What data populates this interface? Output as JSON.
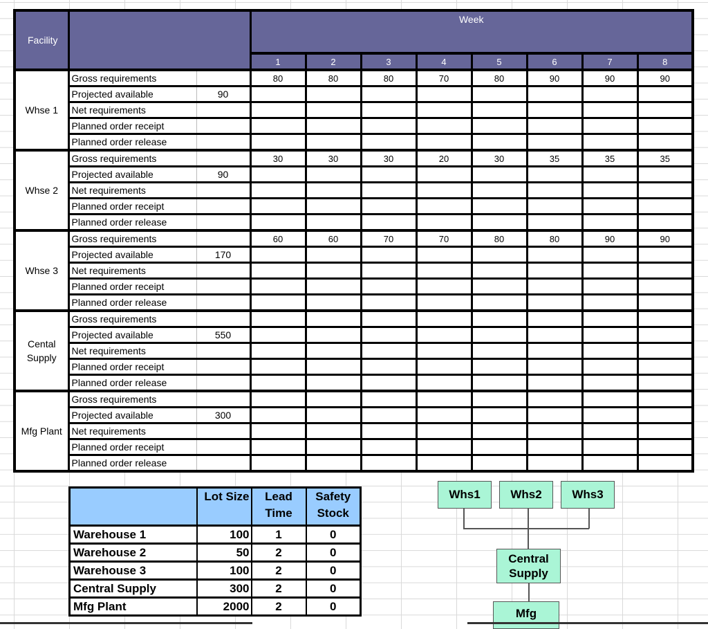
{
  "mrp_table": {
    "header": {
      "facility_label": "Facility",
      "week_label": "Week",
      "weeks": [
        "1",
        "2",
        "3",
        "4",
        "5",
        "6",
        "7",
        "8"
      ]
    },
    "row_labels": [
      "Gross requirements",
      "Projected available",
      "Net requirements",
      "Planned order receipt",
      "Planned order release"
    ],
    "facilities": [
      {
        "name": "Whse 1",
        "projected_available_initial": "90",
        "gross_requirements": [
          "80",
          "80",
          "80",
          "70",
          "80",
          "90",
          "90",
          "90"
        ]
      },
      {
        "name": "Whse 2",
        "projected_available_initial": "90",
        "gross_requirements": [
          "30",
          "30",
          "30",
          "20",
          "30",
          "35",
          "35",
          "35"
        ]
      },
      {
        "name": "Whse 3",
        "projected_available_initial": "170",
        "gross_requirements": [
          "60",
          "60",
          "70",
          "70",
          "80",
          "80",
          "90",
          "90"
        ]
      },
      {
        "name": "Cental Supply",
        "projected_available_initial": "550",
        "gross_requirements": [
          "",
          "",
          "",
          "",
          "",
          "",
          "",
          ""
        ]
      },
      {
        "name": "Mfg Plant",
        "projected_available_initial": "300",
        "gross_requirements": [
          "",
          "",
          "",
          "",
          "",
          "",
          "",
          ""
        ]
      }
    ]
  },
  "parameters_table": {
    "headers": [
      "",
      "Lot Size",
      "Lead Time",
      "Safety Stock"
    ],
    "rows": [
      {
        "name": "Warehouse 1",
        "lot_size": "100",
        "lead_time": "1",
        "safety_stock": "0"
      },
      {
        "name": "Warehouse 2",
        "lot_size": "50",
        "lead_time": "2",
        "safety_stock": "0"
      },
      {
        "name": "Warehouse 3",
        "lot_size": "100",
        "lead_time": "2",
        "safety_stock": "0"
      },
      {
        "name": "Central Supply",
        "lot_size": "300",
        "lead_time": "2",
        "safety_stock": "0"
      },
      {
        "name": "Mfg Plant",
        "lot_size": "2000",
        "lead_time": "2",
        "safety_stock": "0"
      }
    ]
  },
  "network_diagram": {
    "nodes": {
      "whs1": "Whs1",
      "whs2": "Whs2",
      "whs3": "Whs3",
      "central_supply": "Central Supply",
      "mfg": "Mfg"
    }
  },
  "colors": {
    "header_fill": "#666699",
    "param_header_fill": "#99ccff",
    "node_fill": "#aaf5d6"
  }
}
